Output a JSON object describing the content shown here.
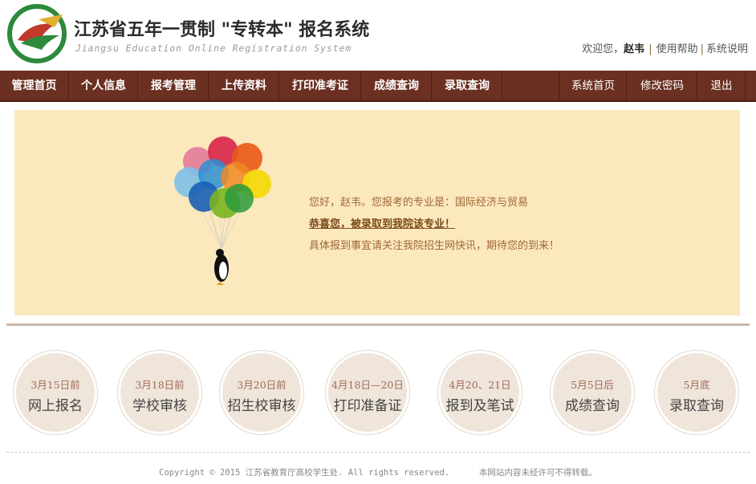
{
  "header": {
    "title_cn": "江苏省五年一贯制 \"专转本\" 报名系统",
    "title_en": "Jiangsu Education Online Registration System",
    "welcome_prefix": "欢迎您，",
    "user_name": "赵韦",
    "help_link": "使用帮助",
    "about_link": "系统说明"
  },
  "nav": {
    "items": [
      "管理首页",
      "个人信息",
      "报考管理",
      "上传资料",
      "打印准考证",
      "成绩查询",
      "录取查询"
    ],
    "right_items": [
      "系统首页",
      "修改密码",
      "退出"
    ],
    "background": "#6b3022"
  },
  "banner": {
    "line1": "您好，赵韦。您报考的专业是：国际经济与贸易",
    "line2": "恭喜您，被录取到我院该专业！",
    "line3": "具体报到事宜请关注我院招生网快讯，期待您的到来！",
    "background": "#fbe8bc"
  },
  "steps": [
    {
      "date": "3月15日前",
      "name": "网上报名"
    },
    {
      "date": "3月18日前",
      "name": "学校审核"
    },
    {
      "date": "3月20日前",
      "name": "招生校审核"
    },
    {
      "date": "4月18日—20日",
      "name": "打印准备证"
    },
    {
      "date": "4月20、21日",
      "name": "报到及笔试"
    },
    {
      "date": "5月5日后",
      "name": "成绩查询"
    },
    {
      "date": "5月底",
      "name": "录取查询"
    }
  ],
  "footer": {
    "copyright": "Copyright © 2015 江苏省教育厅高校学生处. All rights reserved.",
    "notice": "本网站内容未经许可不得转载。"
  },
  "icons": {
    "logo": "logo-icon",
    "balloons": "balloons-penguin-illustration"
  }
}
